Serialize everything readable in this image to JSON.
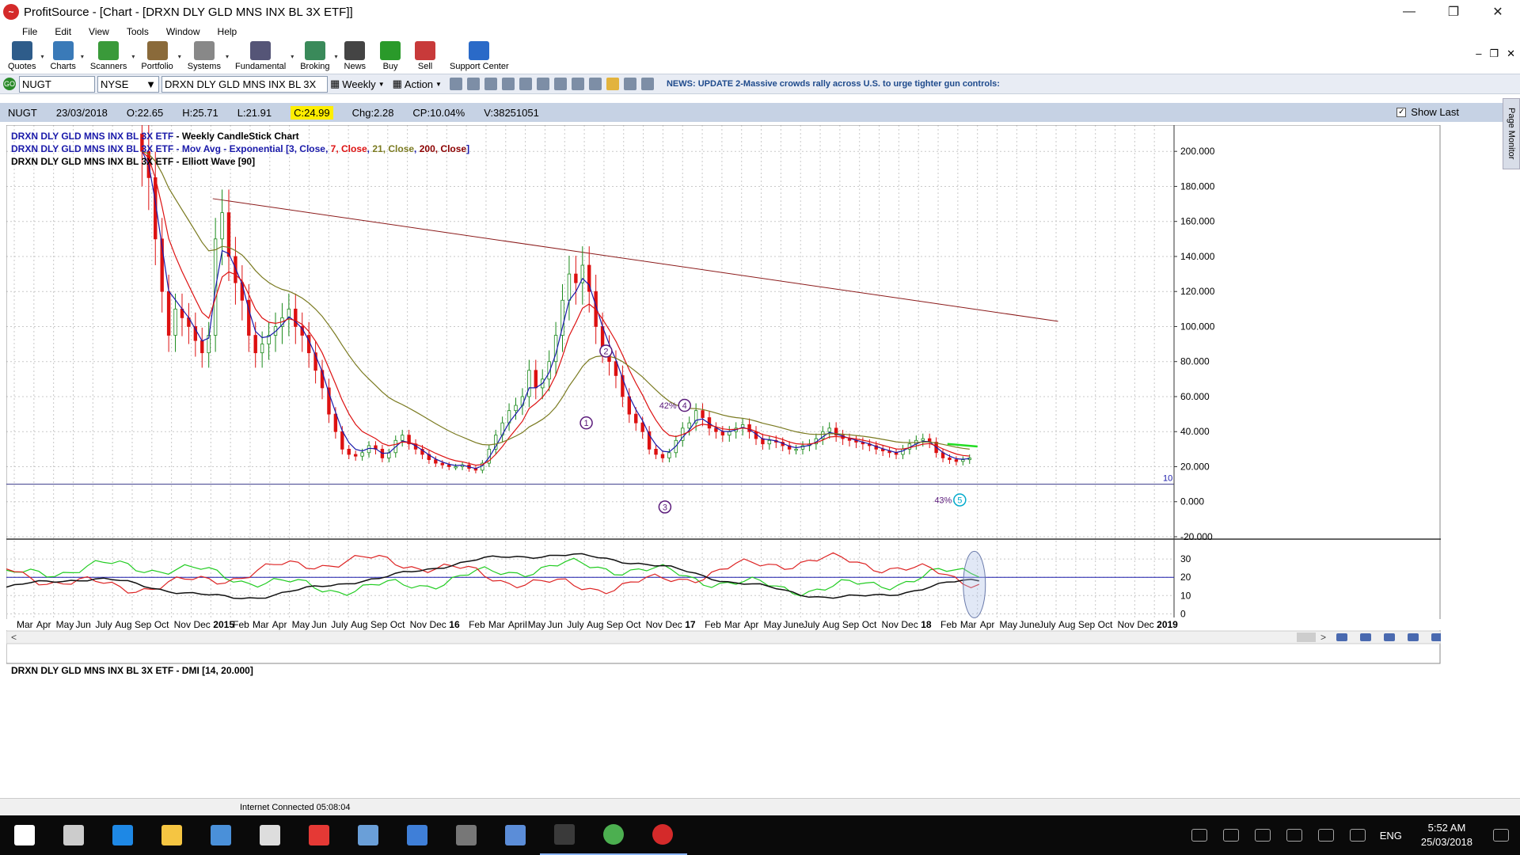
{
  "window": {
    "title": "ProfitSource - [Chart - [DRXN DLY GLD MNS INX BL 3X ETF]]",
    "logo": "profitsource-logo"
  },
  "menu": [
    "File",
    "Edit",
    "View",
    "Tools",
    "Window",
    "Help"
  ],
  "toolbar": [
    {
      "label": "Quotes",
      "icon": "quotes-icon",
      "color": "#2e5c8a"
    },
    {
      "label": "Charts",
      "icon": "charts-icon",
      "color": "#3a7ab8"
    },
    {
      "label": "Scanners",
      "icon": "scanners-icon",
      "color": "#3a9a3a"
    },
    {
      "label": "Portfolio",
      "icon": "portfolio-icon",
      "color": "#8a6a3a"
    },
    {
      "label": "Systems",
      "icon": "systems-icon",
      "color": "#888888"
    },
    {
      "label": "Fundamental",
      "icon": "fundamental-icon",
      "color": "#555577"
    },
    {
      "label": "Broking",
      "icon": "broking-icon",
      "color": "#3a8a5a"
    },
    {
      "label": "News",
      "icon": "news-icon",
      "color": "#444444"
    },
    {
      "label": "Buy",
      "icon": "buy-icon",
      "color": "#2a9a2a"
    },
    {
      "label": "Sell",
      "icon": "sell-icon",
      "color": "#c83a3a"
    },
    {
      "label": "Support Center",
      "icon": "help-icon",
      "color": "#2a6ac8"
    }
  ],
  "symbolbar": {
    "symbol": "NUGT",
    "exchange": "NYSE",
    "security_name": "DRXN DLY GLD MNS INX BL 3X",
    "period": "Weekly",
    "action": "Action",
    "news": "NEWS: UPDATE 2-Massive crowds rally across U.S. to urge tighter gun controls:"
  },
  "infobar": {
    "symbol": "NUGT",
    "date": "23/03/2018",
    "open": "O:22.65",
    "high": "H:25.71",
    "low": "L:21.91",
    "close": "C:24.99",
    "change": "Chg:2.28",
    "change_pct": "CP:10.04%",
    "volume": "V:38251051",
    "show_last": "Show Last"
  },
  "page_monitor": "Page Monitor",
  "legend": {
    "line1_prefix": "DRXN DLY GLD MNS INX BL 3X ETF",
    "line1_suffix": " - Weekly CandleStick Chart",
    "line2_prefix": "DRXN DLY GLD MNS INX BL 3X ETF",
    "line2_mid": " - Mov Avg - Exponential [",
    "p1": "3, Close",
    "p2": "7, Close",
    "p3": "21, Close",
    "p4": "200, Close",
    "line3_prefix": "DRXN DLY GLD MNS INX BL 3X ETF",
    "line3_suffix": " - Elliott Wave [90]",
    "dmi": "DRXN DLY GLD MNS INX BL 3X ETF - DMI [14, 20.000]"
  },
  "chart_data": {
    "type": "candlestick",
    "price_axis": {
      "ticks": [
        "200.000",
        "180.000",
        "160.000",
        "140.000",
        "120.000",
        "100.000",
        "80.000",
        "60.000",
        "40.000",
        "20.000",
        "0.000",
        "-20.000"
      ],
      "values": [
        200,
        180,
        160,
        140,
        120,
        100,
        80,
        60,
        40,
        20,
        0,
        -20
      ],
      "ylim": [
        -20,
        215
      ]
    },
    "dmi_axis": {
      "ticks": [
        "30",
        "20",
        "10",
        "0"
      ],
      "values": [
        30,
        20,
        10,
        0
      ],
      "ylim": [
        -2,
        40
      ]
    },
    "horizontal_line": {
      "label": "10",
      "value": 10
    },
    "trendline": {
      "from": {
        "x": "Jan 2015",
        "y": 173
      },
      "to": {
        "x": "Aug 2018",
        "y": 103
      }
    },
    "elliott_wave": [
      {
        "label": "1",
        "x": "Aug 2016",
        "y": 45
      },
      {
        "label": "2",
        "x": "Sep 2016",
        "y": 86
      },
      {
        "label": "3",
        "x": "Dec 2016",
        "y": -3
      },
      {
        "label": "4",
        "x": "Jan 2017",
        "y": 55,
        "pct": "42%"
      },
      {
        "label": "5",
        "x": "Mar 2018",
        "y": 1,
        "pct": "43%"
      }
    ],
    "time_axis": [
      "Mar",
      "Apr",
      "May",
      "Jun",
      "July",
      "Aug",
      "Sep",
      "Oct",
      "Nov",
      "Dec",
      "2015",
      "Feb",
      "Mar",
      "Apr",
      "May",
      "Jun",
      "July",
      "Aug",
      "Sep",
      "Oct",
      "Nov",
      "Dec",
      "16",
      "Feb",
      "Mar",
      "April",
      "May",
      "Jun",
      "July",
      "Aug",
      "Sep",
      "Oct",
      "Nov",
      "Dec",
      "17",
      "Feb",
      "Mar",
      "Apr",
      "May",
      "June",
      "July",
      "Aug",
      "Sep",
      "Oct",
      "Nov",
      "Dec",
      "18",
      "Feb",
      "Mar",
      "Apr",
      "May",
      "June",
      "July",
      "Aug",
      "Sep",
      "Oct",
      "Nov",
      "Dec",
      "2019"
    ],
    "bold_labels": [
      "2015",
      "16",
      "17",
      "18",
      "2019"
    ],
    "closes_weekly_approx": [
      200,
      185,
      150,
      120,
      95,
      110,
      105,
      100,
      92,
      85,
      95,
      150,
      165,
      140,
      125,
      115,
      95,
      85,
      90,
      95,
      100,
      105,
      110,
      100,
      95,
      85,
      75,
      65,
      50,
      40,
      30,
      27,
      26,
      28,
      32,
      30,
      25,
      28,
      35,
      38,
      33,
      30,
      27,
      24,
      22,
      21,
      20,
      20,
      21,
      19,
      18,
      22,
      30,
      38,
      45,
      52,
      55,
      60,
      75,
      65,
      70,
      80,
      95,
      115,
      130,
      125,
      135,
      120,
      100,
      88,
      80,
      72,
      60,
      50,
      45,
      40,
      30,
      27,
      25,
      28,
      35,
      42,
      45,
      52,
      48,
      42,
      40,
      38,
      40,
      42,
      44,
      40,
      36,
      33,
      35,
      34,
      32,
      30,
      30,
      32,
      33,
      36,
      40,
      42,
      38,
      36,
      35,
      34,
      33,
      32,
      30,
      29,
      28,
      27,
      30,
      33,
      35,
      36,
      34,
      28,
      25,
      24,
      23,
      24,
      25
    ],
    "series": [
      {
        "name": "3, Close",
        "color": "#1a1aaa"
      },
      {
        "name": "7, Close",
        "color": "#dd1111"
      },
      {
        "name": "21, Close",
        "color": "#7a7a20"
      },
      {
        "name": "200, Close",
        "color": "#8b0000"
      }
    ],
    "dmi_series": [
      {
        "name": "+DI",
        "color": "#22cc22"
      },
      {
        "name": "-DI",
        "color": "#dd2222"
      },
      {
        "name": "ADX",
        "color": "#111111"
      }
    ],
    "grid": true
  },
  "statusbar": {
    "text": "Internet Connected 05:08:04"
  },
  "taskbar": {
    "apps": [
      "windows-start-icon",
      "task-view-icon",
      "edge-icon",
      "file-explorer-icon",
      "store-icon",
      "calculator-icon",
      "kaspersky-icon",
      "paint-icon",
      "defender-icon",
      "camera-icon",
      "remote-desktop-icon",
      "go-icon",
      "chrome-icon",
      "profitsource-icon"
    ],
    "lang": "ENG",
    "time": "5:52 AM",
    "date": "25/03/2018"
  }
}
